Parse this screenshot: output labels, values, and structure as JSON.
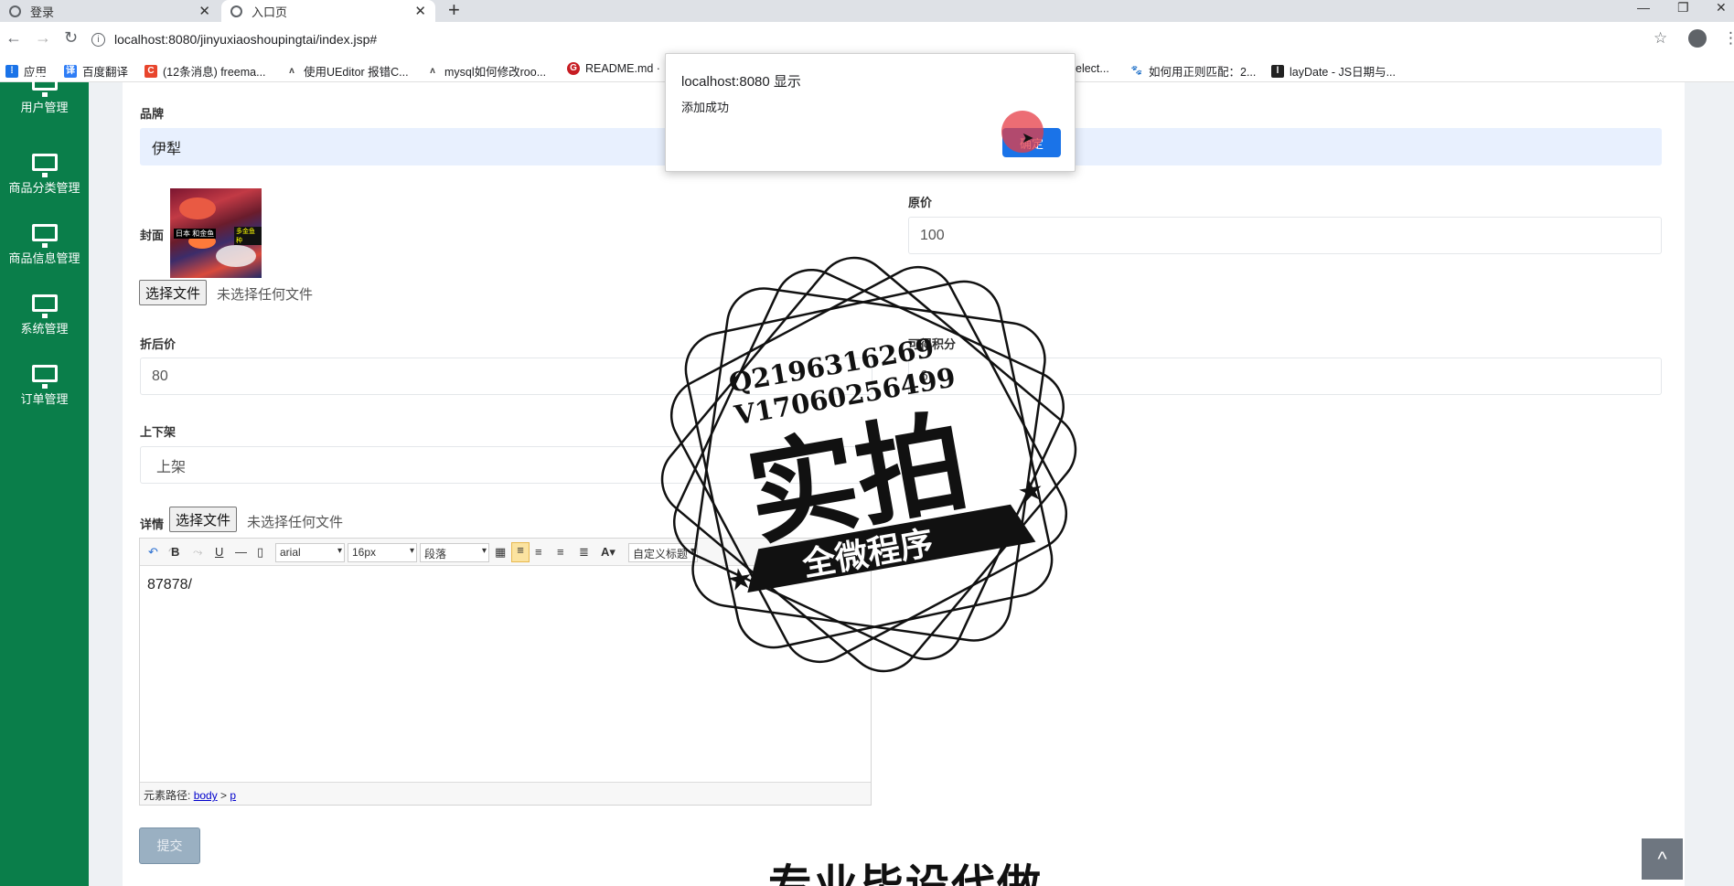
{
  "browser": {
    "tabs": [
      {
        "title": "登录",
        "active": false
      },
      {
        "title": "入口页",
        "active": true
      }
    ],
    "new_tab": "+",
    "url": "localhost:8080/jinyuxiaoshoupingtai/index.jsp#",
    "bookmarks": [
      {
        "label": "应用",
        "icon": "apps-icon",
        "color": "#1a73e8"
      },
      {
        "label": "百度翻译",
        "icon": "baidu-translate-icon",
        "color": "#2e7df6"
      },
      {
        "label": "(12条消息) freema...",
        "icon": "csdn-icon",
        "color": "#e8452c"
      },
      {
        "label": "使用UEditor 报错C...",
        "icon": "ueditor-icon",
        "color": "#555555"
      },
      {
        "label": "mysql如何修改roo...",
        "icon": "mysql-icon",
        "color": "#555555"
      },
      {
        "label": "README.md ·",
        "icon": "gitee-icon",
        "color": "#c71d23"
      },
      {
        "label": "elect...",
        "icon": "page-icon",
        "color": "#555555"
      },
      {
        "label": "如何用正则匹配：2...",
        "icon": "baidu-paw-icon",
        "color": "#2932e1"
      },
      {
        "label": "layDate - JS日期与...",
        "icon": "laydate-icon",
        "color": "#222222"
      }
    ]
  },
  "sidebar": {
    "color": "#0a7e4a",
    "items": [
      {
        "label": "用户管理"
      },
      {
        "label": "商品分类管理"
      },
      {
        "label": "商品信息管理"
      },
      {
        "label": "系统管理"
      },
      {
        "label": "订单管理"
      }
    ]
  },
  "form": {
    "brand": {
      "label": "品牌",
      "value": "伊犁"
    },
    "cover": {
      "label": "封面",
      "image_text_1": "日本 和金鱼",
      "image_text_2": "多金鱼种",
      "file_button": "选择文件",
      "file_status": "未选择任何文件"
    },
    "original_price": {
      "label": "原价",
      "value": "100"
    },
    "discount_price": {
      "label": "折后价",
      "value": "80"
    },
    "points": {
      "label": "可得积分",
      "value": "6"
    },
    "status": {
      "label": "上下架",
      "value": "上架"
    },
    "details": {
      "label": "详情",
      "file_button": "选择文件",
      "file_status": "未选择任何文件"
    },
    "submit": "提交"
  },
  "editor": {
    "font": "arial",
    "size": "16px",
    "paragraph": "段落",
    "custom_title": "自定义标题",
    "content": "87878/",
    "path_label": "元素路径:",
    "path_body": "body",
    "path_sep": " > ",
    "path_p": "p"
  },
  "dialog": {
    "title": "localhost:8080 显示",
    "message": "添加成功",
    "ok_button": "确定"
  },
  "watermark": {
    "line1": "Q2196316269",
    "line2": "V17060256499",
    "main": "实拍",
    "banner": "全微程序"
  },
  "bottom_text": "专业毕设代做",
  "back_to_top": "^"
}
